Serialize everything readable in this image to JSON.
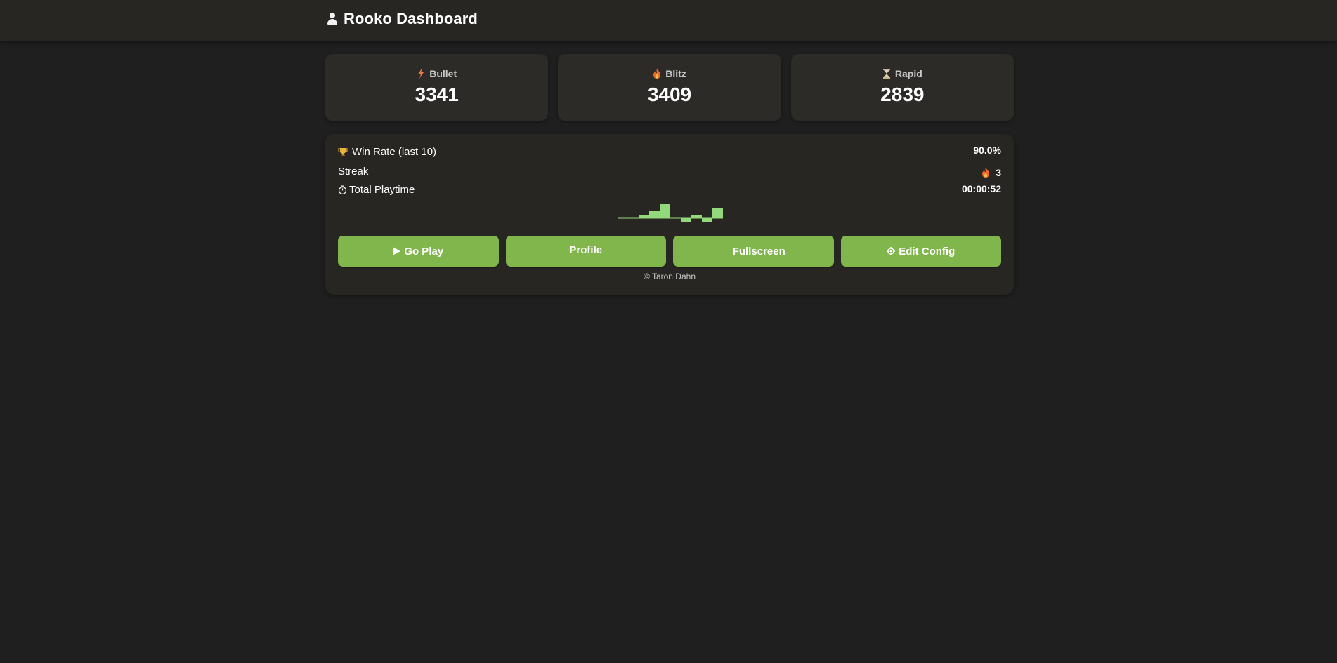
{
  "header": {
    "title": "Rooko Dashboard",
    "icon": "user-icon"
  },
  "ratings": [
    {
      "label": "Bullet",
      "value": "3341",
      "icon": "lightning-icon"
    },
    {
      "label": "Blitz",
      "value": "3409",
      "icon": "flame-icon"
    },
    {
      "label": "Rapid",
      "value": "2839",
      "icon": "hourglass-icon"
    }
  ],
  "stats": {
    "win_rate": {
      "label": "Win Rate (last 10)",
      "value": "90.0%",
      "icon": "trophy-icon"
    },
    "streak": {
      "label": "Streak",
      "value": "3",
      "icon": "flame-icon"
    },
    "playtime": {
      "label": "Total Playtime",
      "value": "00:00:52",
      "icon": "stopwatch-icon"
    }
  },
  "sparkline": {
    "values": [
      0,
      0,
      1,
      2,
      4,
      0,
      -1,
      1,
      -1,
      3
    ],
    "color": "#93d97c"
  },
  "buttons": {
    "go_play": "Go Play",
    "profile": "Profile",
    "fullscreen": "Fullscreen",
    "edit_config": "Edit Config"
  },
  "footer": {
    "credit": "© Taron Dahn"
  },
  "colors": {
    "accent": "#81b64c",
    "background": "#1f1f1f",
    "panel": "#282622",
    "card": "#2d2b27"
  }
}
